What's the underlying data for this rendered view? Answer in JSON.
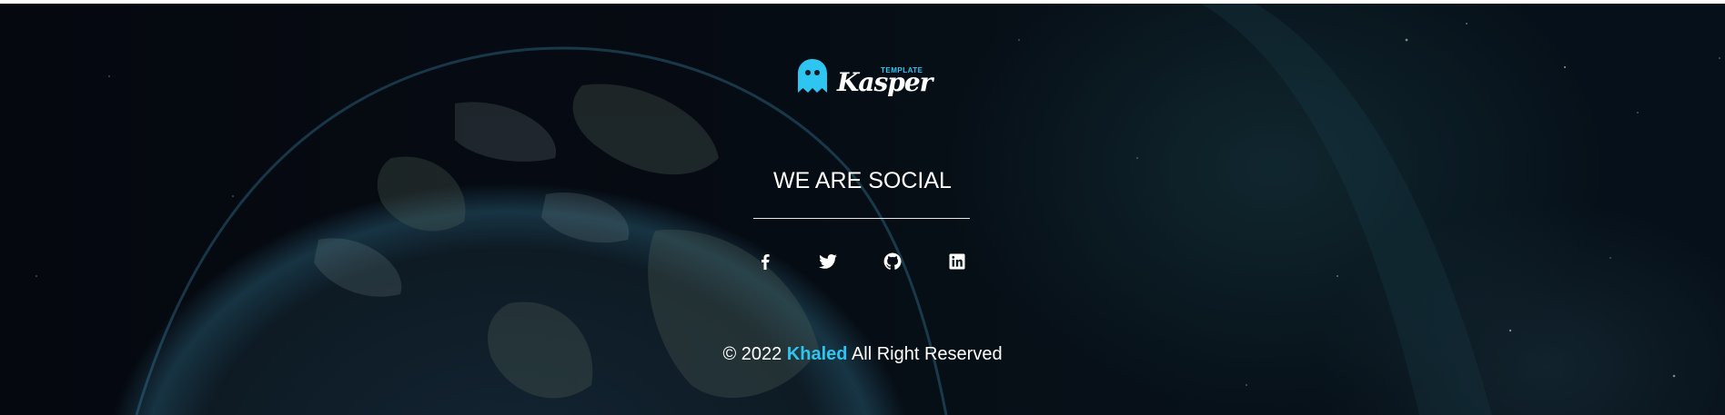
{
  "logo": {
    "small_label": "TEMPLATE",
    "name": "Kasper",
    "accent_color": "#2ec5f0"
  },
  "social": {
    "heading": "WE ARE SOCIAL",
    "links": [
      {
        "icon": "facebook-icon"
      },
      {
        "icon": "twitter-icon"
      },
      {
        "icon": "github-icon"
      },
      {
        "icon": "linkedin-icon"
      }
    ]
  },
  "copyright": {
    "prefix": "© 2022",
    "brand": "Khaled",
    "suffix": "All Right Reserved"
  }
}
